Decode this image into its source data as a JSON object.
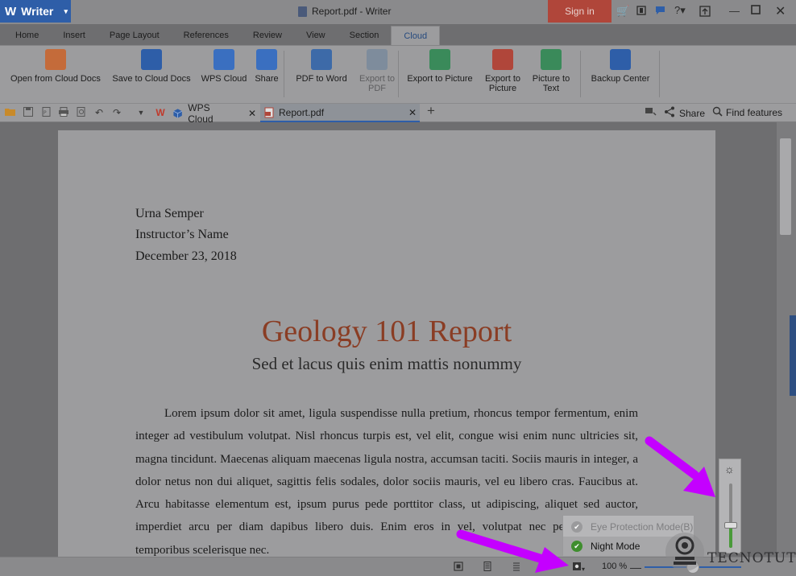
{
  "window": {
    "app_name": "Writer",
    "title": "Report.pdf - Writer",
    "sign_in_label": "Sign in",
    "accent": "#2e5ea8",
    "signin_color": "#b0463a"
  },
  "menu_tabs": [
    "Home",
    "Insert",
    "Page Layout",
    "References",
    "Review",
    "View",
    "Section",
    "Cloud"
  ],
  "active_menu_tab": "Cloud",
  "ribbon": [
    {
      "label": "Open from Cloud Docs",
      "icon": "folder-cloud-icon",
      "enabled": true
    },
    {
      "label": "Save to Cloud Docs",
      "icon": "save-cloud-icon",
      "enabled": true
    },
    {
      "label": "WPS Cloud",
      "icon": "cube-icon",
      "enabled": true
    },
    {
      "label": "Share",
      "icon": "share-icon",
      "enabled": true
    },
    {
      "label": "PDF to Word",
      "icon": "pdf-to-word-icon",
      "enabled": true
    },
    {
      "label": "Export to PDF",
      "icon": "export-pdf-icon",
      "enabled": false
    },
    {
      "label": "Export to Picture",
      "icon": "export-picture-icon",
      "enabled": true
    },
    {
      "label": "Export to Picture",
      "icon": "export-picture-alt-icon",
      "enabled": true
    },
    {
      "label": "Picture to Text",
      "icon": "picture-to-text-icon",
      "enabled": true
    },
    {
      "label": "Backup Center",
      "icon": "backup-icon",
      "enabled": true
    }
  ],
  "doc_tabs": [
    {
      "label": "WPS Cloud",
      "icon": "cube-icon"
    },
    {
      "label": "Report.pdf",
      "icon": "pdf-file-icon",
      "active": true
    }
  ],
  "quickbar_right": {
    "share_label": "Share",
    "find_label": "Find features"
  },
  "document": {
    "header_lines": [
      "Urna Semper",
      "Instructor’s Name",
      "December 23, 2018"
    ],
    "heading": "Geology 101 Report",
    "subheading": "Sed et lacus quis enim mattis nonummy",
    "body": "Lorem ipsum dolor sit amet, ligula suspendisse nulla pretium, rhoncus tempor fermentum, enim integer ad vestibulum volutpat. Nisl rhoncus turpis est, vel elit, congue wisi enim nunc ultricies sit, magna tincidunt. Maecenas aliquam maecenas ligula nostra, accumsan taciti. Sociis mauris in integer, a dolor netus non dui aliquet, sagittis felis sodales, dolor sociis mauris, vel eu libero cras. Faucibus at. Arcu habitasse elementum est, ipsum purus pede porttitor class, ut adipiscing, aliquet sed auctor, imperdiet arcu per diam dapibus libero duis. Enim eros in vel, volutpat nec pellentesque leo, temporibus scelerisque nec."
  },
  "mode_popup": {
    "items": [
      {
        "label": "Eye Protection Mode(B)",
        "checked": false
      },
      {
        "label": "Night Mode",
        "checked": true
      }
    ]
  },
  "brightness": {
    "level": 0.35
  },
  "status": {
    "zoom": "100 %",
    "zoom_fraction": 0.5
  },
  "watermark": {
    "text": "TECNOTUTO"
  },
  "annotation_color": "#c400ff"
}
